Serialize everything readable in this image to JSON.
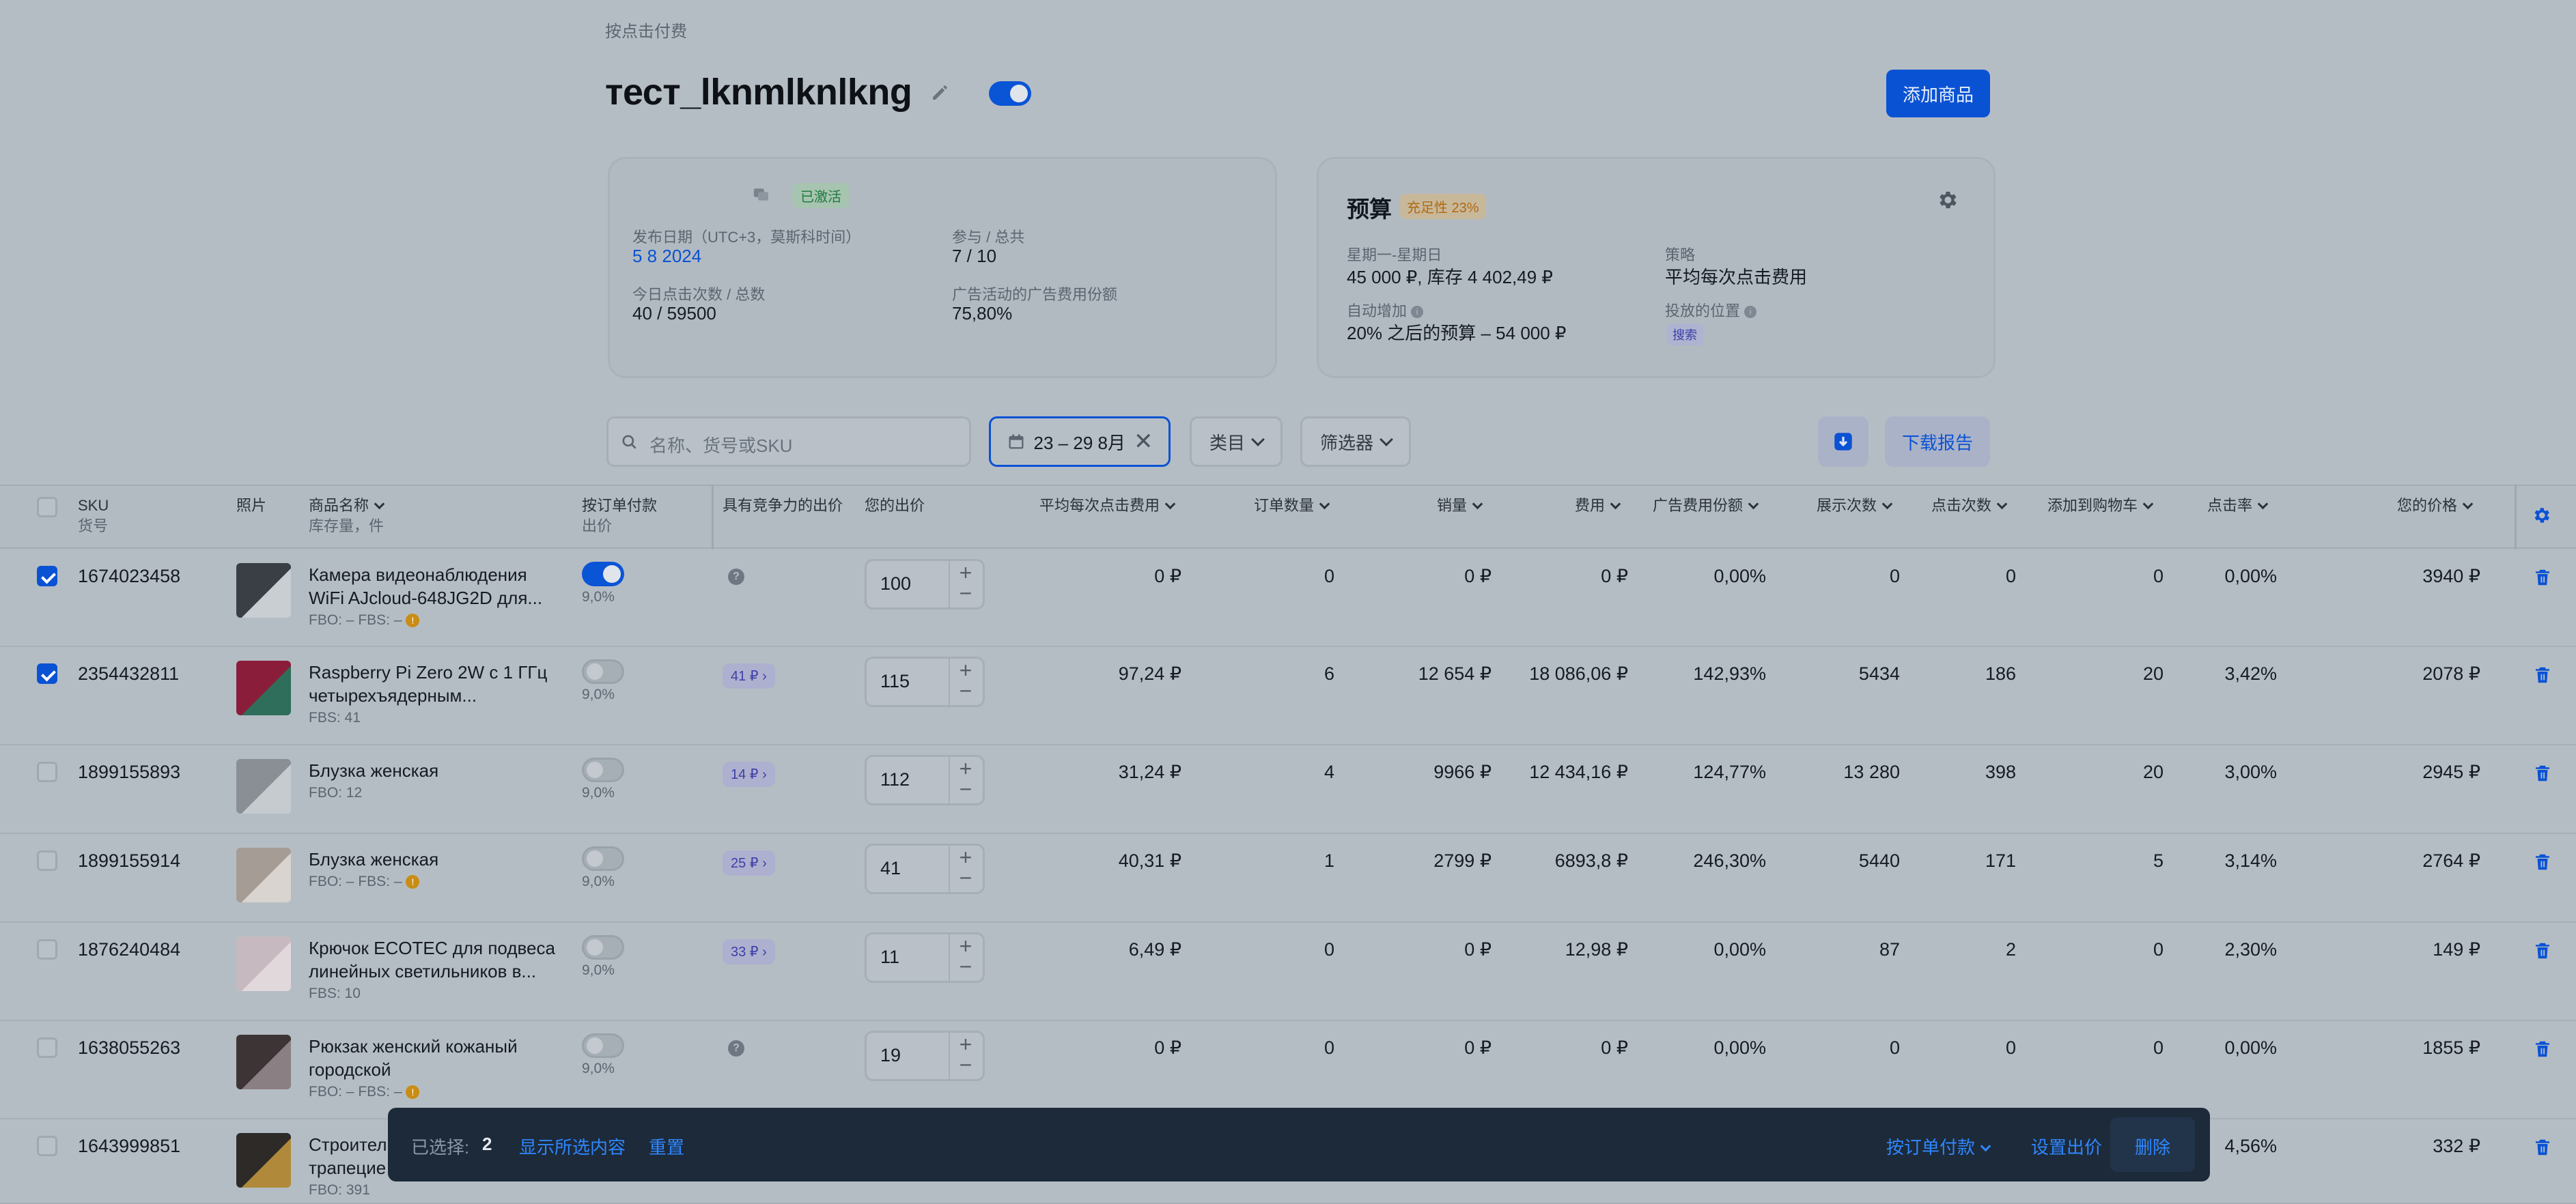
{
  "breadcrumb": "按点击付费",
  "campaign": {
    "title": "тест_lknmlknlkng",
    "add_button": "添加商品"
  },
  "status_card": {
    "status_badge": "已激活",
    "publish_label": "发布日期（UTC+3，莫斯科时间）",
    "publish_value": "5 8 2024",
    "participate_label": "参与 / 总共",
    "participate_value": "7 / 10",
    "clicks_label": "今日点击次数 / 总数",
    "clicks_value": "40 / 59500",
    "share_label": "广告活动的广告费用份额",
    "share_value": "75,80%"
  },
  "budget_card": {
    "title": "预算",
    "fill_badge": "充足性 23%",
    "days_label": "星期一-星期日",
    "days_value": "45 000 ₽, 库存 4 402,49 ₽",
    "strategy_label": "策略",
    "strategy_value": "平均每次点击费用",
    "auto_label": "自动增加",
    "auto_value": "20% 之后的预算 – 54 000 ₽",
    "placement_label": "投放的位置",
    "placement_badge": "搜索"
  },
  "toolbar": {
    "search_placeholder": "名称、货号或SKU",
    "date_range": "23 – 29 8月",
    "category": "类目",
    "filter": "筛选器",
    "download_report": "下载报告"
  },
  "table": {
    "headers": {
      "sku": "SKU",
      "sku_sub": "货号",
      "photo": "照片",
      "name": "商品名称",
      "name_sub": "库存量，件",
      "pay_per_order": "按订单付款",
      "pay_per_order_sub": "出价",
      "competitive": "具有竞争力的出价",
      "your_bid": "您的出价",
      "avg_cpc": "平均每次点击费用",
      "orders": "订单数量",
      "sales": "销量",
      "cost": "费用",
      "drr": "广告费用份额",
      "impressions": "展示次数",
      "clicks": "点击次数",
      "add_to_cart": "添加到购物车",
      "ctr": "点击率",
      "price": "您的价格"
    },
    "rows": [
      {
        "sku": "1674023458",
        "name1": "Камера видеонаблюдения",
        "name2": "WiFi AJcloud-648JG2D для...",
        "stock": "FBO: –   FBS: –",
        "warn": "!",
        "toggle_on": true,
        "pct": "9,0%",
        "comp": "?",
        "bid": "100",
        "cpc": "0 ₽",
        "orders": "0",
        "sales": "0 ₽",
        "cost": "0 ₽",
        "drr": "0,00%",
        "impr": "0",
        "clicks": "0",
        "cart": "0",
        "ctr": "0,00%",
        "price": "3940 ₽",
        "checked": true
      },
      {
        "sku": "2354432811",
        "name1": "Raspberry Pi Zero 2W с 1 ГГц",
        "name2": "четырехъядерным...",
        "stock": "FBS: 41",
        "warn": "",
        "toggle_on": false,
        "pct": "9,0%",
        "comp": "41 ₽ ›",
        "bid": "115",
        "cpc": "97,24 ₽",
        "orders": "6",
        "sales": "12 654 ₽",
        "cost": "18 086,06 ₽",
        "drr": "142,93%",
        "impr": "5434",
        "clicks": "186",
        "cart": "20",
        "ctr": "3,42%",
        "price": "2078 ₽",
        "checked": true
      },
      {
        "sku": "1899155893",
        "name1": "Блузка женская",
        "name2": "",
        "stock": "FBO: 12",
        "warn": "",
        "toggle_on": false,
        "pct": "9,0%",
        "comp": "14 ₽ ›",
        "bid": "112",
        "cpc": "31,24 ₽",
        "orders": "4",
        "sales": "9966 ₽",
        "cost": "12 434,16 ₽",
        "drr": "124,77%",
        "impr": "13 280",
        "clicks": "398",
        "cart": "20",
        "ctr": "3,00%",
        "price": "2945 ₽",
        "checked": false
      },
      {
        "sku": "1899155914",
        "name1": "Блузка женская",
        "name2": "",
        "stock": "FBO: –   FBS: –",
        "warn": "!",
        "toggle_on": false,
        "pct": "9,0%",
        "comp": "25 ₽ ›",
        "bid": "41",
        "cpc": "40,31 ₽",
        "orders": "1",
        "sales": "2799 ₽",
        "cost": "6893,8 ₽",
        "drr": "246,30%",
        "impr": "5440",
        "clicks": "171",
        "cart": "5",
        "ctr": "3,14%",
        "price": "2764 ₽",
        "checked": false
      },
      {
        "sku": "1876240484",
        "name1": "Крючок ECOTEC для подвеса",
        "name2": "линейных светильников в...",
        "stock": "FBS: 10",
        "warn": "",
        "toggle_on": false,
        "pct": "9,0%",
        "comp": "33 ₽ ›",
        "bid": "11",
        "cpc": "6,49 ₽",
        "orders": "0",
        "sales": "0 ₽",
        "cost": "12,98 ₽",
        "drr": "0,00%",
        "impr": "87",
        "clicks": "2",
        "cart": "0",
        "ctr": "2,30%",
        "price": "149 ₽",
        "checked": false
      },
      {
        "sku": "1638055263",
        "name1": "Рюкзак женский кожаный",
        "name2": "городской",
        "stock": "FBO: –   FBS: –",
        "warn": "!",
        "toggle_on": false,
        "pct": "9,0%",
        "comp": "?",
        "bid": "19",
        "cpc": "0 ₽",
        "orders": "0",
        "sales": "0 ₽",
        "cost": "0 ₽",
        "drr": "0,00%",
        "impr": "0",
        "clicks": "0",
        "cart": "0",
        "ctr": "0,00%",
        "price": "1855 ₽",
        "checked": false
      },
      {
        "sku": "1643999851",
        "name1": "Строител",
        "name2": "трапецие",
        "stock": "FBO: 391",
        "warn": "",
        "toggle_on": false,
        "pct": "",
        "comp": "",
        "bid": "",
        "cpc": "",
        "orders": "",
        "sales": "",
        "cost": "",
        "drr": "",
        "impr": "",
        "clicks": "",
        "cart": "",
        "ctr": "4,56%",
        "price": "332 ₽",
        "checked": false
      }
    ]
  },
  "bulk_bar": {
    "selected_label": "已选择:",
    "selected_count": "2",
    "show_selected": "显示所选内容",
    "reset": "重置",
    "pay_per_order": "按订单付款",
    "set_bid": "设置出价",
    "delete": "删除"
  },
  "colors": {
    "accent": "#0a52d4",
    "overlay_bg": "#b5bdc4",
    "bar_bg": "#1c2a3a"
  }
}
